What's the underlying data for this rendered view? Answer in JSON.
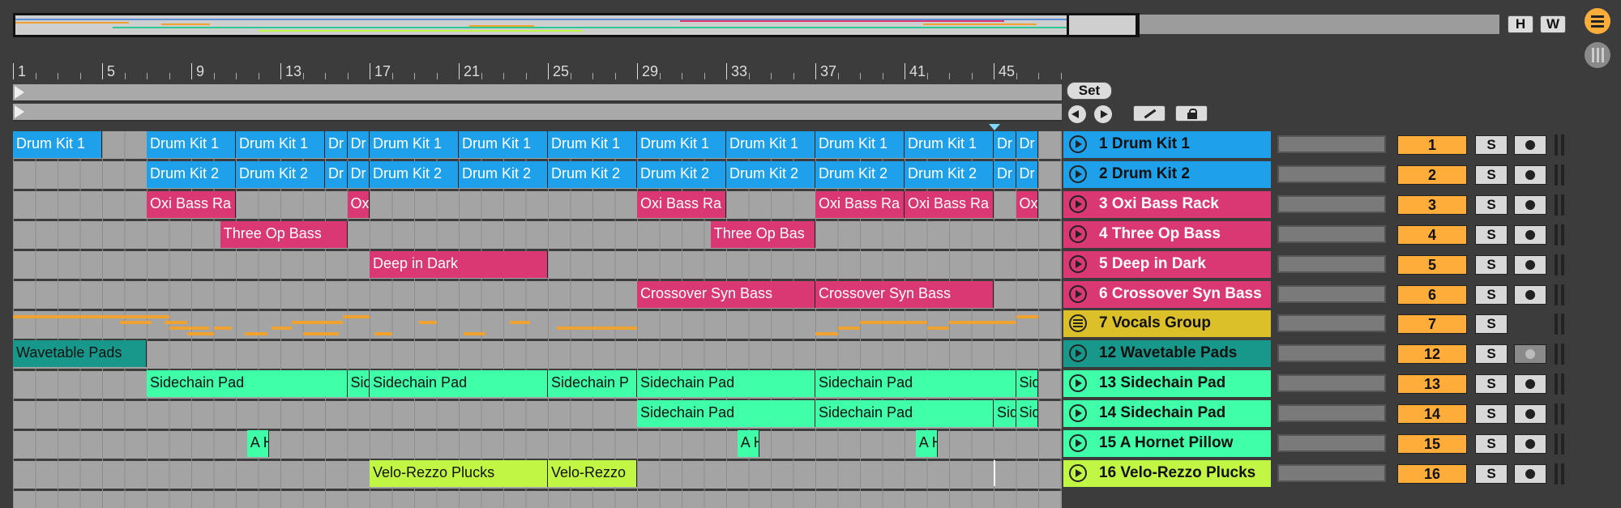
{
  "overview": {
    "h_label": "H",
    "w_label": "W"
  },
  "ruler": {
    "bars": [
      "1",
      "5",
      "9",
      "13",
      "17",
      "21",
      "25",
      "29",
      "33",
      "37",
      "41",
      "45"
    ]
  },
  "controls": {
    "set_label": "Set",
    "back_icon": "prev-locator-icon",
    "fwd_icon": "next-locator-icon",
    "draw_icon": "pencil-icon",
    "lock_icon": "lock-icon"
  },
  "side_icons": [
    "menu-icon",
    "browser-icon"
  ],
  "tracks": [
    {
      "name": "1 Drum Kit 1",
      "number": "1",
      "color": "#1fa0ea",
      "text_color": "#111",
      "act": "play",
      "mon": true
    },
    {
      "name": "2 Drum Kit 2",
      "number": "2",
      "color": "#1fa0ea",
      "text_color": "#111",
      "act": "play",
      "mon": true
    },
    {
      "name": "3 Oxi Bass Rack",
      "number": "3",
      "color": "#d93872",
      "text_color": "#fff",
      "act": "play",
      "mon": true
    },
    {
      "name": "4 Three Op Bass",
      "number": "4",
      "color": "#d93872",
      "text_color": "#fff",
      "act": "play",
      "mon": true
    },
    {
      "name": "5 Deep in Dark",
      "number": "5",
      "color": "#d93872",
      "text_color": "#fff",
      "act": "play",
      "mon": true
    },
    {
      "name": "6 Crossover Syn Bass",
      "number": "6",
      "color": "#d93872",
      "text_color": "#fff",
      "act": "play",
      "mon": true
    },
    {
      "name": "7 Vocals Group",
      "number": "7",
      "color": "#dcc02a",
      "text_color": "#111",
      "act": "fold",
      "mon": null
    },
    {
      "name": "12 Wavetable Pads",
      "number": "12",
      "color": "#17988a",
      "text_color": "#111",
      "act": "play",
      "mon": false
    },
    {
      "name": "13 Sidechain Pad",
      "number": "13",
      "color": "#3fffa8",
      "text_color": "#111",
      "act": "play",
      "mon": true
    },
    {
      "name": "14 Sidechain Pad",
      "number": "14",
      "color": "#3fffa8",
      "text_color": "#111",
      "act": "play",
      "mon": true
    },
    {
      "name": "15 A Hornet Pillow",
      "number": "15",
      "color": "#3fffa8",
      "text_color": "#111",
      "act": "play",
      "mon": true
    },
    {
      "name": "16 Velo-Rezzo Plucks",
      "number": "16",
      "color": "#c1f744",
      "text_color": "#111",
      "act": "play",
      "mon": true
    }
  ],
  "solo_label": "S",
  "clips": [
    {
      "track": 0,
      "start": 1,
      "end": 5,
      "label": "Drum Kit 1",
      "cls": "c-blue"
    },
    {
      "track": 0,
      "start": 7,
      "end": 11,
      "label": "Drum Kit 1",
      "cls": "c-blue"
    },
    {
      "track": 0,
      "start": 11,
      "end": 15,
      "label": "Drum Kit 1",
      "cls": "c-blue"
    },
    {
      "track": 0,
      "start": 15,
      "end": 16,
      "label": "Dr",
      "cls": "c-blue"
    },
    {
      "track": 0,
      "start": 16,
      "end": 17,
      "label": "Dr",
      "cls": "c-blue"
    },
    {
      "track": 0,
      "start": 17,
      "end": 21,
      "label": "Drum Kit 1",
      "cls": "c-blue"
    },
    {
      "track": 0,
      "start": 21,
      "end": 25,
      "label": "Drum Kit 1",
      "cls": "c-blue"
    },
    {
      "track": 0,
      "start": 25,
      "end": 29,
      "label": "Drum Kit 1",
      "cls": "c-blue"
    },
    {
      "track": 0,
      "start": 29,
      "end": 33,
      "label": "Drum Kit 1",
      "cls": "c-blue"
    },
    {
      "track": 0,
      "start": 33,
      "end": 37,
      "label": "Drum Kit 1",
      "cls": "c-blue"
    },
    {
      "track": 0,
      "start": 37,
      "end": 41,
      "label": "Drum Kit 1",
      "cls": "c-blue"
    },
    {
      "track": 0,
      "start": 41,
      "end": 45,
      "label": "Drum Kit 1",
      "cls": "c-blue"
    },
    {
      "track": 0,
      "start": 45,
      "end": 46,
      "label": "Dr",
      "cls": "c-blue"
    },
    {
      "track": 0,
      "start": 46,
      "end": 47,
      "label": "Dr",
      "cls": "c-blue"
    },
    {
      "track": 1,
      "start": 7,
      "end": 11,
      "label": "Drum Kit 2",
      "cls": "c-blue"
    },
    {
      "track": 1,
      "start": 11,
      "end": 15,
      "label": "Drum Kit 2",
      "cls": "c-blue"
    },
    {
      "track": 1,
      "start": 15,
      "end": 16,
      "label": "Dr",
      "cls": "c-blue"
    },
    {
      "track": 1,
      "start": 16,
      "end": 17,
      "label": "Dr",
      "cls": "c-blue"
    },
    {
      "track": 1,
      "start": 17,
      "end": 21,
      "label": "Drum Kit 2",
      "cls": "c-blue"
    },
    {
      "track": 1,
      "start": 21,
      "end": 25,
      "label": "Drum Kit 2",
      "cls": "c-blue"
    },
    {
      "track": 1,
      "start": 25,
      "end": 29,
      "label": "Drum Kit 2",
      "cls": "c-blue"
    },
    {
      "track": 1,
      "start": 29,
      "end": 33,
      "label": "Drum Kit 2",
      "cls": "c-blue"
    },
    {
      "track": 1,
      "start": 33,
      "end": 37,
      "label": "Drum Kit 2",
      "cls": "c-blue"
    },
    {
      "track": 1,
      "start": 37,
      "end": 41,
      "label": "Drum Kit 2",
      "cls": "c-blue"
    },
    {
      "track": 1,
      "start": 41,
      "end": 45,
      "label": "Drum Kit 2",
      "cls": "c-blue"
    },
    {
      "track": 1,
      "start": 45,
      "end": 46,
      "label": "Dr",
      "cls": "c-blue"
    },
    {
      "track": 1,
      "start": 46,
      "end": 47,
      "label": "Dr",
      "cls": "c-blue"
    },
    {
      "track": 2,
      "start": 7,
      "end": 11,
      "label": "Oxi Bass Ra",
      "cls": "c-pink"
    },
    {
      "track": 2,
      "start": 16,
      "end": 17,
      "label": "Ox",
      "cls": "c-pink"
    },
    {
      "track": 2,
      "start": 29,
      "end": 33,
      "label": "Oxi Bass Ra",
      "cls": "c-pink"
    },
    {
      "track": 2,
      "start": 37,
      "end": 41,
      "label": "Oxi Bass Ra",
      "cls": "c-pink"
    },
    {
      "track": 2,
      "start": 41,
      "end": 45,
      "label": "Oxi Bass Ra",
      "cls": "c-pink"
    },
    {
      "track": 2,
      "start": 46,
      "end": 47,
      "label": "Ox",
      "cls": "c-pink"
    },
    {
      "track": 3,
      "start": 10.3,
      "end": 16,
      "label": "Three Op Bass",
      "cls": "c-pink"
    },
    {
      "track": 3,
      "start": 32.3,
      "end": 37,
      "label": "Three Op Bas",
      "cls": "c-pink"
    },
    {
      "track": 4,
      "start": 17,
      "end": 25,
      "label": "Deep in Dark",
      "cls": "c-pink"
    },
    {
      "track": 5,
      "start": 29,
      "end": 37,
      "label": "Crossover Syn Bass",
      "cls": "c-pink"
    },
    {
      "track": 5,
      "start": 37,
      "end": 45,
      "label": "Crossover Syn Bass",
      "cls": "c-pink"
    },
    {
      "track": 7,
      "start": 1,
      "end": 7,
      "label": "Wavetable Pads",
      "cls": "c-teal"
    },
    {
      "track": 8,
      "start": 7,
      "end": 16,
      "label": "Sidechain Pad",
      "cls": "c-green"
    },
    {
      "track": 8,
      "start": 16,
      "end": 17,
      "label": "Sid",
      "cls": "c-green"
    },
    {
      "track": 8,
      "start": 17,
      "end": 25,
      "label": "Sidechain Pad",
      "cls": "c-green"
    },
    {
      "track": 8,
      "start": 25,
      "end": 29,
      "label": "Sidechain P",
      "cls": "c-green"
    },
    {
      "track": 8,
      "start": 29,
      "end": 37,
      "label": "Sidechain Pad",
      "cls": "c-green"
    },
    {
      "track": 8,
      "start": 37,
      "end": 46,
      "label": "Sidechain Pad",
      "cls": "c-green"
    },
    {
      "track": 8,
      "start": 46,
      "end": 47,
      "label": "Sid",
      "cls": "c-green"
    },
    {
      "track": 9,
      "start": 29,
      "end": 37,
      "label": "Sidechain Pad",
      "cls": "c-green"
    },
    {
      "track": 9,
      "start": 37,
      "end": 45,
      "label": "Sidechain Pad",
      "cls": "c-green"
    },
    {
      "track": 9,
      "start": 45,
      "end": 46,
      "label": "Sid",
      "cls": "c-green"
    },
    {
      "track": 9,
      "start": 46,
      "end": 47,
      "label": "Sid",
      "cls": "c-green"
    },
    {
      "track": 10,
      "start": 11.5,
      "end": 12.5,
      "label": "A H",
      "cls": "c-green"
    },
    {
      "track": 10,
      "start": 33.5,
      "end": 34.5,
      "label": "A H",
      "cls": "c-green"
    },
    {
      "track": 10,
      "start": 41.5,
      "end": 42.5,
      "label": "A H",
      "cls": "c-green"
    },
    {
      "track": 11,
      "start": 17,
      "end": 25,
      "label": "Velo-Rezzo Plucks",
      "cls": "c-lime"
    },
    {
      "track": 11,
      "start": 25,
      "end": 29,
      "label": "Velo-Rezzo",
      "cls": "c-lime"
    }
  ]
}
